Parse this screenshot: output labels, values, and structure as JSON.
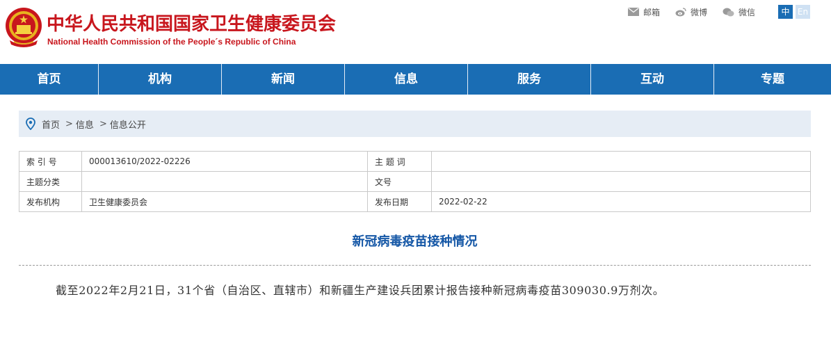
{
  "header": {
    "site_title": "中华人民共和国国家卫生健康委员会",
    "site_subtitle": "National Health Commission of the People´s Republic of China",
    "links": [
      {
        "label": "邮箱",
        "icon": "mail-icon"
      },
      {
        "label": "微博",
        "icon": "weibo-icon"
      },
      {
        "label": "微信",
        "icon": "wechat-icon"
      }
    ],
    "lang_zh": "中",
    "lang_en": "En"
  },
  "nav": {
    "items": [
      "首页",
      "机构",
      "新闻",
      "信息",
      "服务",
      "互动",
      "专题"
    ]
  },
  "breadcrumb": {
    "home": "首页",
    "sep": ">",
    "level1": "信息",
    "level2": "信息公开"
  },
  "info": {
    "index_label": "索 引 号",
    "index_value": "000013610/2022-02226",
    "keywords_label": "主 题 词",
    "keywords_value": "",
    "category_label": "主题分类",
    "category_value": "",
    "docno_label": "文号",
    "docno_value": "",
    "issuer_label": "发布机构",
    "issuer_value": "卫生健康委员会",
    "date_label": "发布日期",
    "date_value": "2022-02-22"
  },
  "article": {
    "title": "新冠病毒疫苗接种情况",
    "body": "截至2022年2月21日，31个省（自治区、直辖市）和新疆生产建设兵团累计报告接种新冠病毒疫苗309030.9万剂次。"
  },
  "colors": {
    "brand_red": "#c8161d",
    "nav_blue": "#1a6db4",
    "title_blue": "#1557a6"
  }
}
